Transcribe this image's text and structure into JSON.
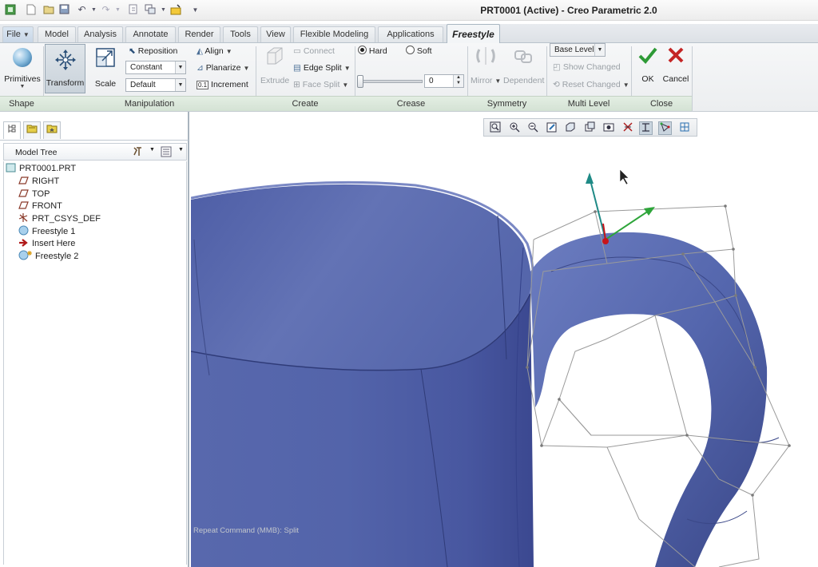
{
  "window": {
    "title": "PRT0001 (Active) - Creo Parametric 2.0"
  },
  "tabs": [
    {
      "label": "File"
    },
    {
      "label": "Model"
    },
    {
      "label": "Analysis"
    },
    {
      "label": "Annotate"
    },
    {
      "label": "Render"
    },
    {
      "label": "Tools"
    },
    {
      "label": "View"
    },
    {
      "label": "Flexible Modeling"
    },
    {
      "label": "Applications"
    },
    {
      "label": "Freestyle"
    }
  ],
  "ribbon": {
    "shape": {
      "primitives": "Primitives",
      "group": "Shape"
    },
    "manipulation": {
      "transform": "Transform",
      "scale": "Scale",
      "reposition": "Reposition",
      "constant": "Constant",
      "default": "Default",
      "align": "Align",
      "planarize": "Planarize",
      "increment": "Increment",
      "increment_icon": "0.1",
      "group": "Manipulation"
    },
    "create": {
      "extrude": "Extrude",
      "connect": "Connect",
      "edge_split": "Edge Split",
      "face_split": "Face Split",
      "group": "Create"
    },
    "crease": {
      "hard": "Hard",
      "soft": "Soft",
      "value": "0",
      "group": "Crease"
    },
    "symmetry": {
      "mirror": "Mirror",
      "dependent": "Dependent",
      "group": "Symmetry"
    },
    "multi_level": {
      "base_level": "Base Level",
      "show_changed": "Show Changed",
      "reset_changed": "Reset Changed",
      "group": "Multi Level"
    },
    "close": {
      "ok": "OK",
      "cancel": "Cancel",
      "group": "Close"
    }
  },
  "model_tree": {
    "title": "Model Tree",
    "items": [
      {
        "label": "PRT0001.PRT",
        "icon": "part-icon"
      },
      {
        "label": "RIGHT",
        "icon": "datum-plane-icon"
      },
      {
        "label": "TOP",
        "icon": "datum-plane-icon"
      },
      {
        "label": "FRONT",
        "icon": "datum-plane-icon"
      },
      {
        "label": "PRT_CSYS_DEF",
        "icon": "csys-icon"
      },
      {
        "label": "Freestyle 1",
        "icon": "freestyle-icon"
      },
      {
        "label": "Insert Here",
        "icon": "insert-arrow-icon"
      },
      {
        "label": "Freestyle 2",
        "icon": "freestyle-active-icon"
      }
    ]
  },
  "status": {
    "hint": "Repeat Command (MMB): Split"
  },
  "colors": {
    "mug": "#5566a8",
    "mug_dark": "#3a4785",
    "accept": "#2e9a36",
    "cancel": "#c42525"
  }
}
